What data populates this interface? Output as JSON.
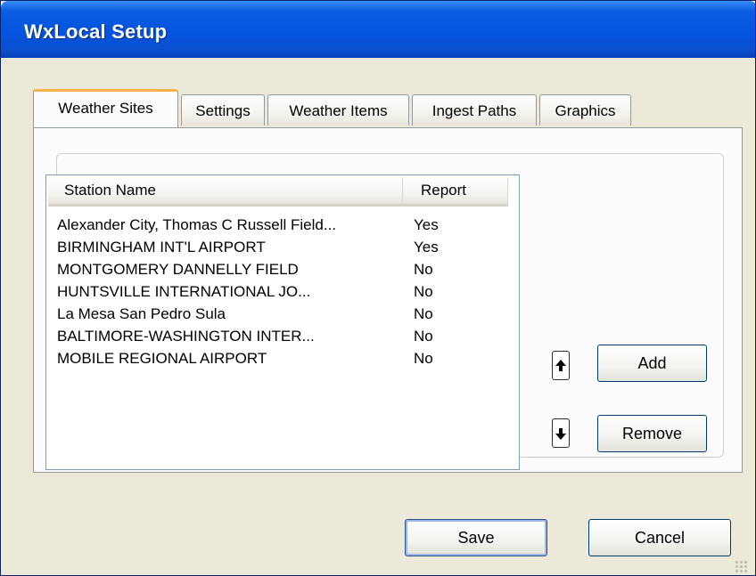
{
  "window": {
    "title": "WxLocal Setup"
  },
  "tabs": [
    {
      "label": "Weather Sites",
      "active": true
    },
    {
      "label": "Settings",
      "active": false
    },
    {
      "label": "Weather Items",
      "active": false
    },
    {
      "label": "Ingest Paths",
      "active": false
    },
    {
      "label": "Graphics",
      "active": false
    }
  ],
  "stations": {
    "columns": [
      "Station Name",
      "Report"
    ],
    "rows": [
      {
        "name": "Alexander City, Thomas C Russell Field...",
        "report": "Yes"
      },
      {
        "name": "BIRMINGHAM INT'L AIRPORT",
        "report": "Yes"
      },
      {
        "name": "MONTGOMERY DANNELLY FIELD",
        "report": "No"
      },
      {
        "name": "HUNTSVILLE INTERNATIONAL  JO...",
        "report": "No"
      },
      {
        "name": "La Mesa San Pedro Sula",
        "report": "No"
      },
      {
        "name": "BALTIMORE-WASHINGTON INTER...",
        "report": "No"
      },
      {
        "name": "MOBILE REGIONAL AIRPORT",
        "report": "No"
      }
    ]
  },
  "buttons": {
    "move_up_icon": "arrow-up-icon",
    "move_down_icon": "arrow-down-icon",
    "add": "Add",
    "remove": "Remove",
    "save": "Save",
    "cancel": "Cancel"
  },
  "colors": {
    "titlebar": "#0554e0",
    "active_tab_accent": "#f9b24a",
    "dialog_background": "#ece9d8",
    "button_border": "#003c74"
  }
}
